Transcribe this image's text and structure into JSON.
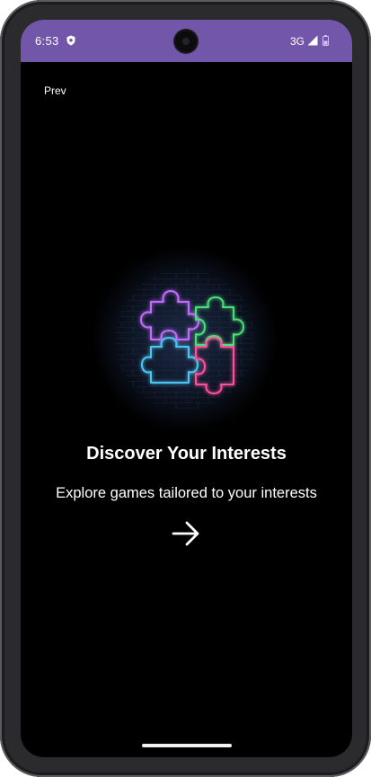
{
  "status_bar": {
    "time": "6:53",
    "network": "3G",
    "color": "#7256a9",
    "icons": [
      "shield-icon",
      "signal-icon",
      "battery-icon"
    ]
  },
  "nav": {
    "prev_label": "Prev",
    "next_icon": "arrow-right-icon"
  },
  "onboarding": {
    "illustration_icon": "neon-puzzle-pieces-icon",
    "title": "Discover Your Interests",
    "subtitle": "Explore games tailored to your interests"
  },
  "colors": {
    "background": "#000000",
    "puzzle_purple": "#c46bff",
    "puzzle_green": "#49e07a",
    "puzzle_blue": "#4cc6f4",
    "puzzle_pink": "#ff4f9e"
  }
}
